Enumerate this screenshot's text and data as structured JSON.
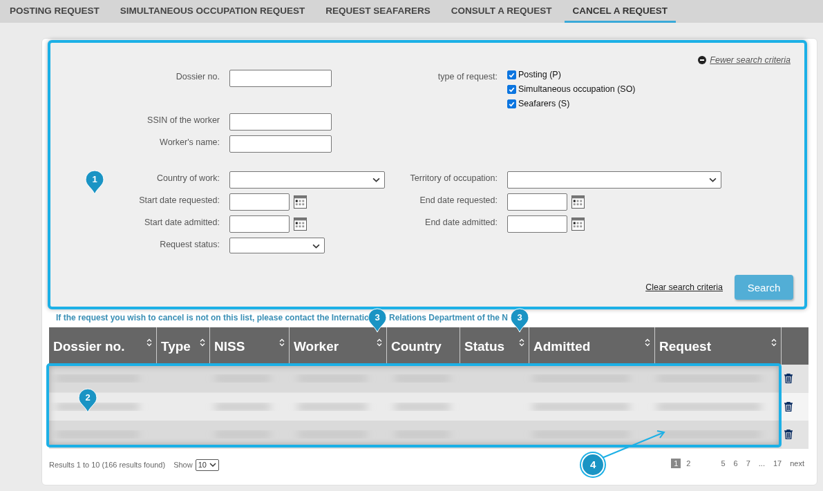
{
  "tabs": [
    {
      "label": "POSTING REQUEST",
      "selected": false
    },
    {
      "label": "SIMULTANEOUS OCCUPATION REQUEST",
      "selected": false
    },
    {
      "label": "REQUEST SEAFARERS",
      "selected": false
    },
    {
      "label": "CONSULT A REQUEST",
      "selected": false
    },
    {
      "label": "CANCEL A REQUEST",
      "selected": true
    }
  ],
  "search_panel": {
    "callout": "1",
    "toggle_link": "Fewer search criteria",
    "groups": [
      [
        {
          "left": {
            "label": "Dossier no.",
            "kind": "text"
          },
          "right": {
            "label": "type of request:",
            "kind": "checkboxes",
            "options": [
              {
                "label": "Posting (P)",
                "checked": true
              },
              {
                "label": "Simultaneous occupation (SO)",
                "checked": true
              },
              {
                "label": "Seafarers (S)",
                "checked": true
              }
            ]
          }
        },
        {
          "left": {
            "label": "SSIN of the worker",
            "kind": "text"
          }
        },
        {
          "left": {
            "label": "Worker's name:",
            "kind": "text"
          }
        }
      ],
      [
        {
          "left": {
            "label": "Country of work:",
            "kind": "select"
          },
          "right": {
            "label": "Territory of occupation:",
            "kind": "select"
          }
        },
        {
          "left": {
            "label": "Start date requested:",
            "kind": "date"
          },
          "right": {
            "label": "End date requested:",
            "kind": "date"
          }
        },
        {
          "left": {
            "label": "Start date admitted:",
            "kind": "date"
          },
          "right": {
            "label": "End date admitted:",
            "kind": "date"
          }
        },
        {
          "left": {
            "label": "Request status:",
            "kind": "short-select"
          }
        }
      ]
    ],
    "clear_link": "Clear search criteria",
    "search_button": "Search"
  },
  "notice": [
    "If the request you wish to cancel is not on this list, please contact the Internatio",
    "Relations Department of the N"
  ],
  "table": {
    "callout": "2",
    "columns": [
      {
        "label": "Dossier no.",
        "sortable": true
      },
      {
        "label": "Type",
        "sortable": true
      },
      {
        "label": "NISS",
        "sortable": true
      },
      {
        "label": "Worker",
        "sortable": true,
        "callout": "3"
      },
      {
        "label": "Country",
        "sortable": false
      },
      {
        "label": "Status",
        "sortable": true,
        "callout": "3"
      },
      {
        "label": "Admitted",
        "sortable": true
      },
      {
        "label": "Request",
        "sortable": true
      }
    ],
    "rows": [
      {
        "redacted": true
      },
      {
        "redacted": true
      },
      {
        "redacted": true
      }
    ]
  },
  "footer": {
    "results": "Results 1 to 10 (166 results found)",
    "show_label": "Show",
    "page_size": "10",
    "callout": "4",
    "pages": [
      {
        "label": "1",
        "selected": true
      },
      {
        "label": "2",
        "selected": false
      },
      {
        "label": "5",
        "selected": false
      },
      {
        "label": "6",
        "selected": false
      },
      {
        "label": "7",
        "selected": false
      }
    ],
    "ellipsis": "...",
    "last_page": "17",
    "next": "next"
  }
}
